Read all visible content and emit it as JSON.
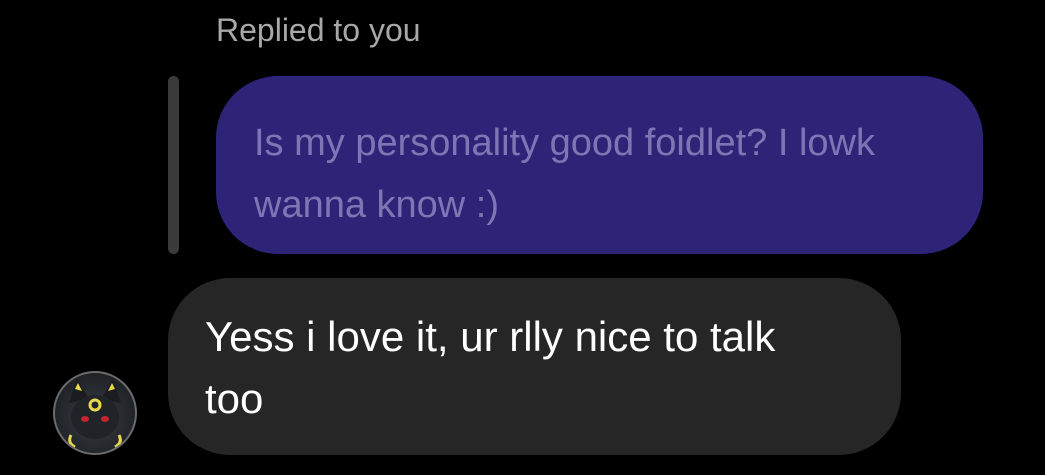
{
  "conversation": {
    "reply_context": "Replied to you",
    "quoted_message": "Is my personality good foidlet? I lowk\nwanna know :)",
    "message": "Yess i love it, ur rlly nice to talk\ntoo"
  },
  "colors": {
    "background": "#000000",
    "quoted_bubble": "#2d2478",
    "quoted_text": "#7c77b4",
    "message_bubble": "#262626",
    "message_text": "#ffffff",
    "reply_context_text": "#a8a8a8"
  },
  "avatar": {
    "icon": "umbreon-avatar-icon"
  }
}
